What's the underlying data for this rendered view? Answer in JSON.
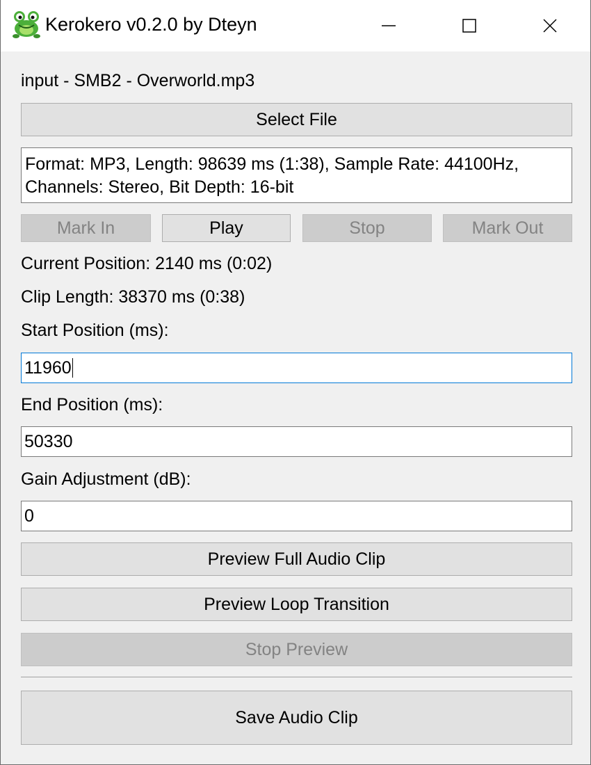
{
  "window": {
    "title": "Kerokero v0.2.0 by Dteyn",
    "icon": "frog-icon",
    "controls": [
      "minimize-icon",
      "maximize-icon",
      "close-icon"
    ]
  },
  "file": {
    "name_label": "input - SMB2 - Overworld.mp3",
    "select_button": "Select File",
    "info_line1": "Format: MP3, Length: 98639 ms (1:38), Sample Rate: 44100Hz,",
    "info_line2": "Channels: Stereo, Bit Depth: 16-bit"
  },
  "transport": {
    "mark_in": "Mark In",
    "play": "Play",
    "stop": "Stop",
    "mark_out": "Mark Out"
  },
  "status": {
    "current_position": "Current Position: 2140 ms (0:02)",
    "clip_length": "Clip Length: 38370 ms (0:38)"
  },
  "fields": {
    "start_label": "Start Position (ms):",
    "start_value": "11960",
    "end_label": "End Position (ms):",
    "end_value": "50330",
    "gain_label": "Gain Adjustment (dB):",
    "gain_value": "0"
  },
  "preview": {
    "full": "Preview Full Audio Clip",
    "loop": "Preview Loop Transition",
    "stop": "Stop Preview"
  },
  "save_button": "Save Audio Clip",
  "colors": {
    "window_bg": "#f0f0f0",
    "button_bg": "#e1e1e1",
    "disabled_bg": "#cccccc",
    "disabled_text": "#838383",
    "focus_border": "#0078d7",
    "frog_green": "#4caf3a"
  }
}
